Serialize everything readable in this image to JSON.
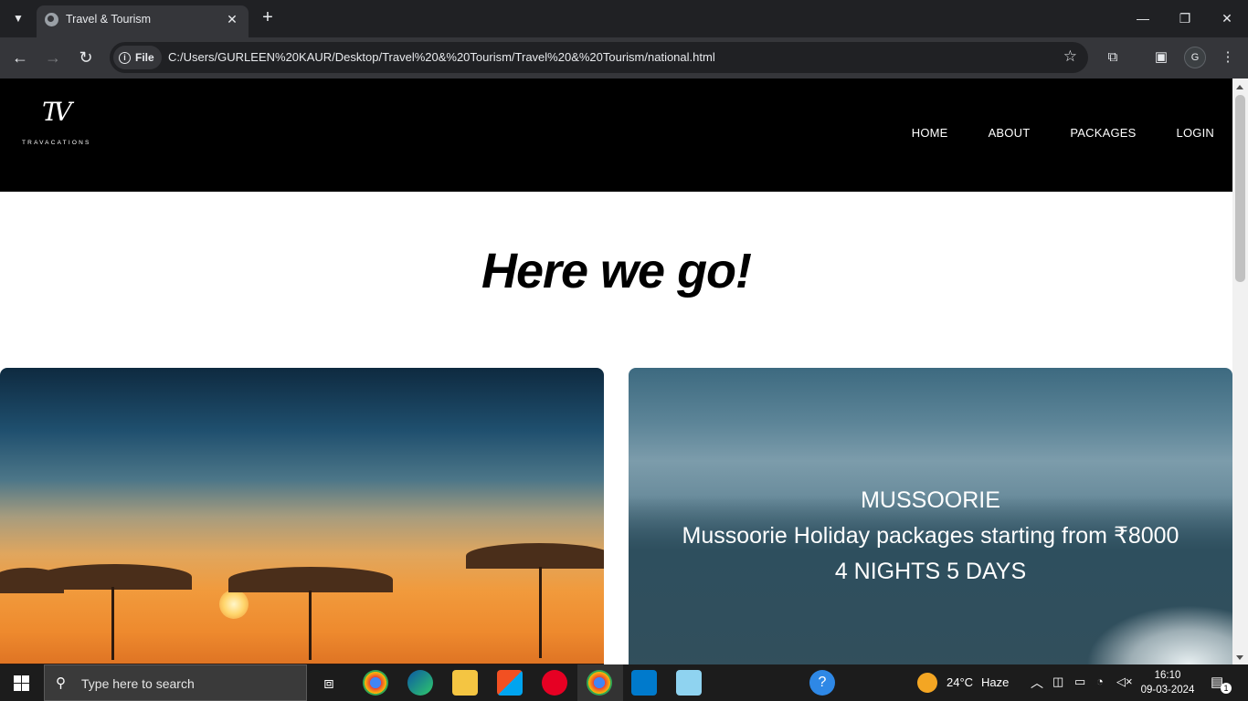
{
  "browser": {
    "tab_title": "Travel & Tourism",
    "tab_close": "✕",
    "new_tab": "+",
    "site_label": "File",
    "url": "C:/Users/GURLEEN%20KAUR/Desktop/Travel%20&%20Tourism/Travel%20&%20Tourism/national.html",
    "profile_initial": "G"
  },
  "site": {
    "logo_mark": "TV",
    "logo_text": "TRAVACATIONS",
    "nav": [
      "HOME",
      "ABOUT",
      "PACKAGES",
      "LOGIN"
    ],
    "hero_title": "Here we go!",
    "cards": [
      {
        "title": "",
        "line1": "",
        "line2": ""
      },
      {
        "title": "MUSSOORIE",
        "line1": "Mussoorie Holiday packages starting from ₹8000",
        "line2": "4 NIGHTS 5 DAYS"
      }
    ]
  },
  "taskbar": {
    "search_placeholder": "Type here to search",
    "weather_temp": "24°C",
    "weather_desc": "Haze",
    "time": "16:10",
    "date": "09-03-2024",
    "notification_count": "1"
  }
}
